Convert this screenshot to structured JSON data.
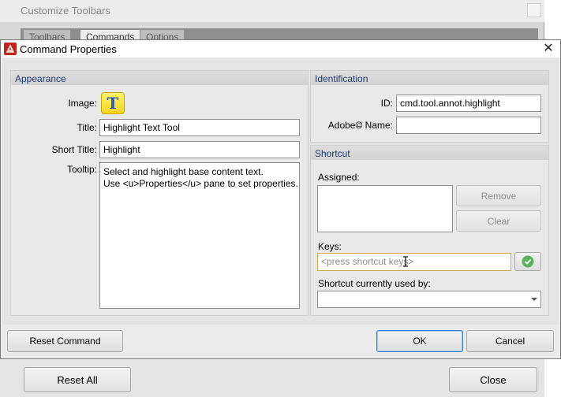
{
  "background_window": {
    "title": "Customize Toolbars",
    "tabs": [
      "Toolbars",
      "Commands",
      "Options"
    ],
    "reset_all_label": "Reset All",
    "close_label": "Close"
  },
  "dialog": {
    "title": "Command Properties",
    "close_glyph": "✕"
  },
  "appearance": {
    "header": "Appearance",
    "image_label": "Image:",
    "image_glyph": "T",
    "title_label": "Title:",
    "title_value": "Highlight Text Tool",
    "short_title_label": "Short Title:",
    "short_title_value": "Highlight",
    "tooltip_label": "Tooltip:",
    "tooltip_lines": [
      "Select and highlight base content text.",
      "Use <u>Properties</u> pane to set properties."
    ]
  },
  "identification": {
    "header": "Identification",
    "id_label": "ID:",
    "id_value": "cmd.tool.annot.highlight",
    "adobe_name_label": "Adobe© Name:",
    "adobe_name_value": ""
  },
  "shortcut": {
    "header": "Shortcut",
    "assigned_label": "Assigned:",
    "remove_label": "Remove",
    "clear_label": "Clear",
    "keys_label": "Keys:",
    "keys_placeholder": "<press shortcut keys>",
    "used_by_label": "Shortcut currently used by:",
    "used_by_value": ""
  },
  "footer": {
    "reset_command_label": "Reset Command",
    "ok_label": "OK",
    "cancel_label": "Cancel"
  },
  "colors": {
    "section_header_text": "#1e3c6e",
    "focus_border": "#d7a643",
    "apply_check": "#58b35a",
    "app_icon": "#c8221d"
  }
}
